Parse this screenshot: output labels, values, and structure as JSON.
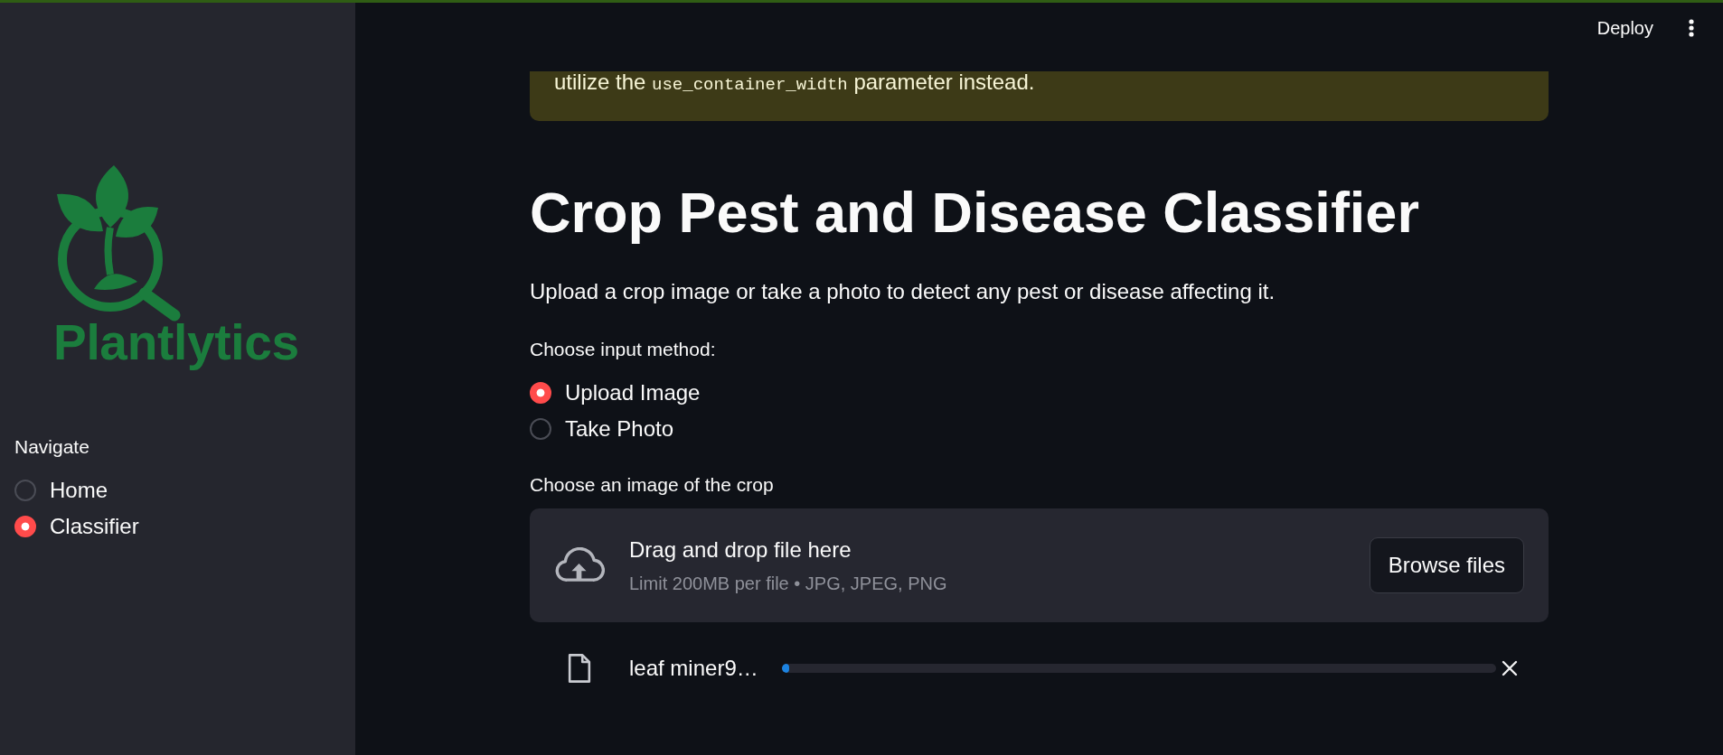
{
  "header": {
    "deploy_label": "Deploy"
  },
  "sidebar": {
    "logo_text": "Plantlytics",
    "nav": {
      "label": "Navigate",
      "options": [
        {
          "label": "Home",
          "selected": false
        },
        {
          "label": "Classifier",
          "selected": true
        }
      ]
    }
  },
  "warning": {
    "parts": [
      {
        "kind": "text",
        "text": "utilize the"
      },
      {
        "kind": "code",
        "text": "use_container_width"
      },
      {
        "kind": "text",
        "text": "parameter instead."
      }
    ]
  },
  "page": {
    "title": "Crop Pest and Disease Classifier",
    "description": "Upload a crop image or take a photo to detect any pest or disease affecting it.",
    "input_method": {
      "label": "Choose input method:",
      "options": [
        {
          "label": "Upload Image",
          "selected": true
        },
        {
          "label": "Take Photo",
          "selected": false
        }
      ]
    },
    "uploader": {
      "label": "Choose an image of the crop",
      "dropzone": {
        "title": "Drag and drop file here",
        "hint": "Limit 200MB per file • JPG, JPEG, PNG",
        "button": "Browse files"
      },
      "files": [
        {
          "name": "leaf miner9…",
          "level": 0.01
        }
      ]
    }
  }
}
